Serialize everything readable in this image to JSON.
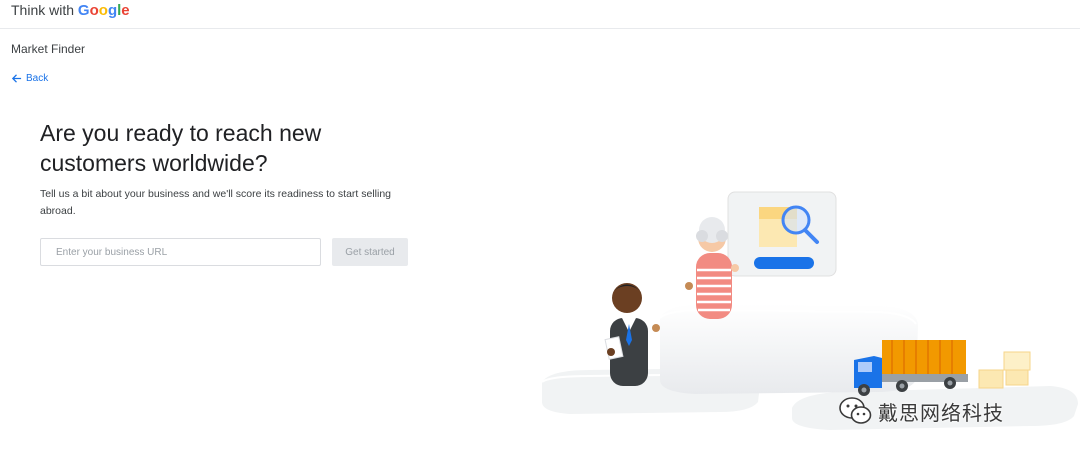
{
  "header": {
    "brand_prefix": "Think with",
    "brand_letters": [
      "G",
      "o",
      "o",
      "g",
      "l",
      "e"
    ]
  },
  "product": {
    "name": "Market Finder"
  },
  "nav": {
    "back_label": "Back"
  },
  "hero": {
    "headline": "Are you ready to reach new customers worldwide?",
    "subtext": "Tell us a bit about your business and we'll score its readiness to start selling abroad."
  },
  "form": {
    "url_placeholder": "Enter your business URL",
    "url_value": "",
    "submit_label": "Get started"
  },
  "watermark": {
    "text": "戴思网络科技"
  },
  "colors": {
    "link": "#1a73e8",
    "google_blue": "#4285f4",
    "google_red": "#ea4335",
    "google_yellow": "#fbbc05",
    "google_green": "#34a853",
    "button_disabled_bg": "#e8eaed"
  }
}
